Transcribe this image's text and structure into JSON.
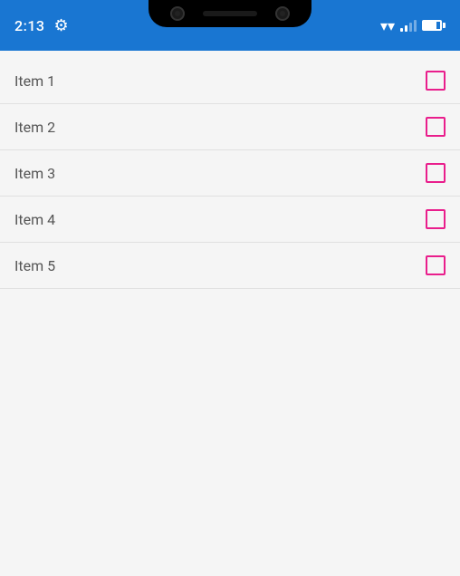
{
  "statusBar": {
    "time": "2:13",
    "backgroundColor": "#1976D2"
  },
  "items": [
    {
      "id": 1,
      "label": "Item 1",
      "checked": false
    },
    {
      "id": 2,
      "label": "Item 2",
      "checked": false
    },
    {
      "id": 3,
      "label": "Item 3",
      "checked": false
    },
    {
      "id": 4,
      "label": "Item 4",
      "checked": false
    },
    {
      "id": 5,
      "label": "Item 5",
      "checked": false
    }
  ]
}
